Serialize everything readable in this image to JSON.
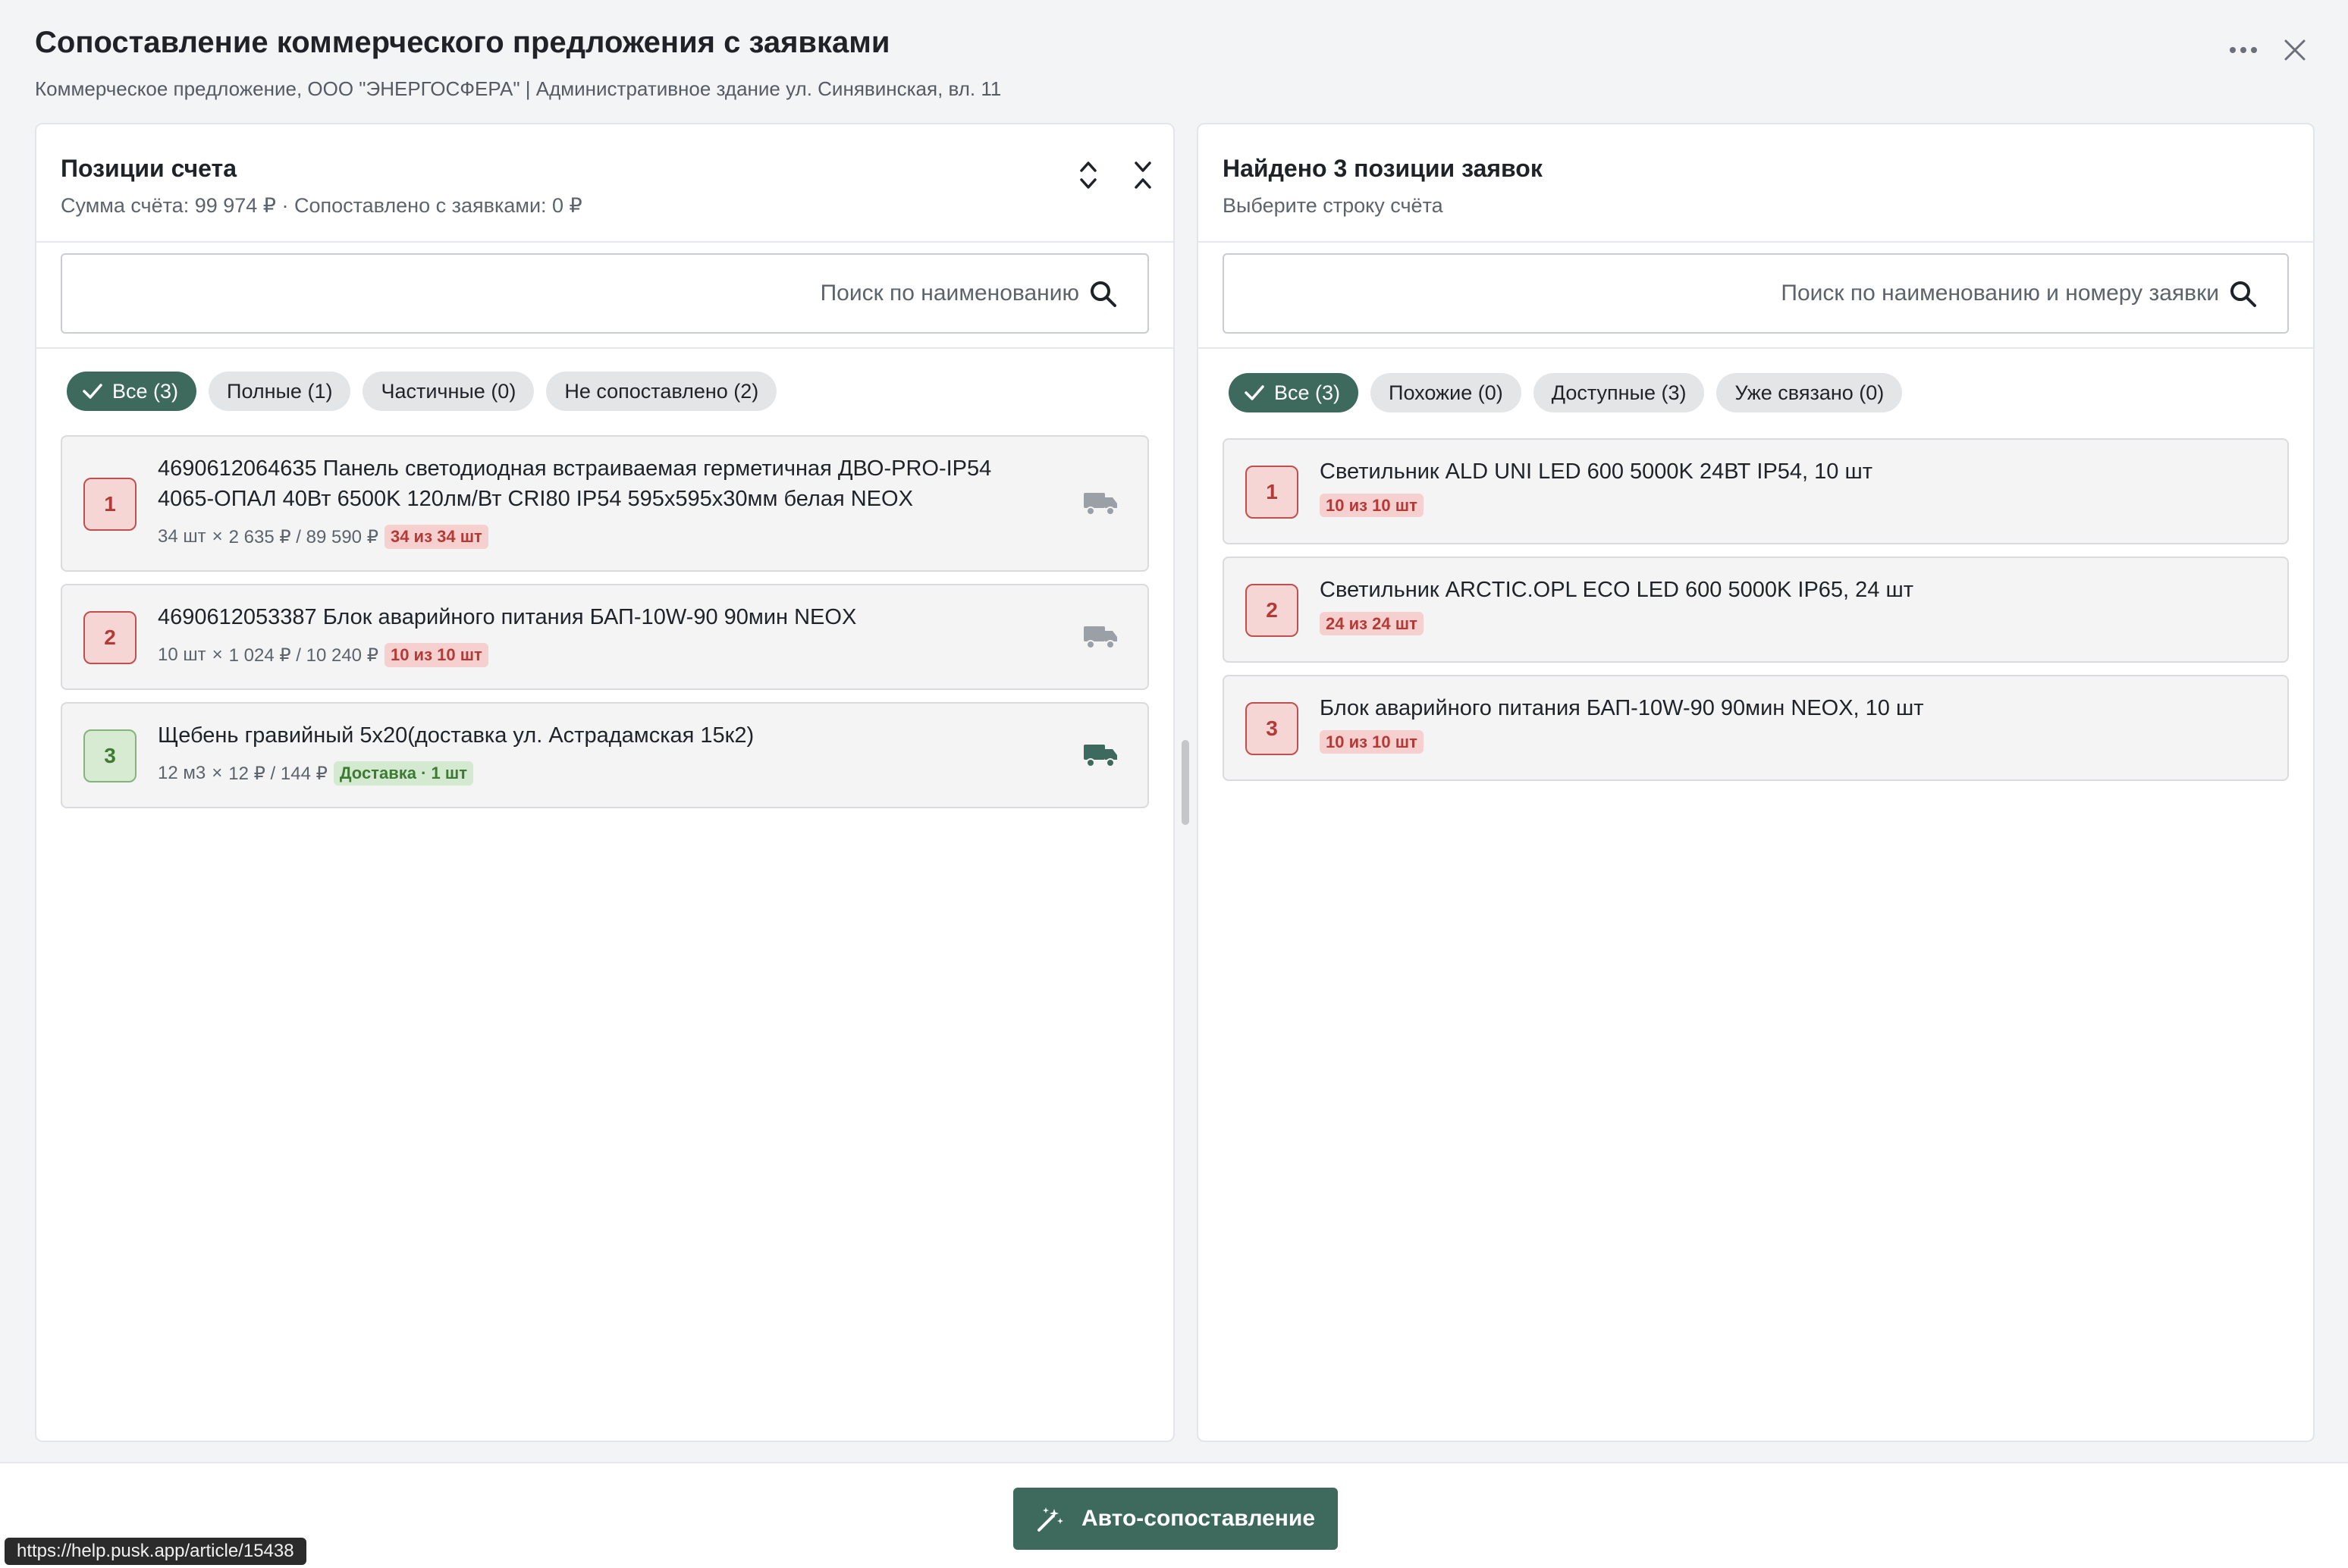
{
  "header": {
    "title": "Сопоставление коммерческого предложения с заявками",
    "subtitle": "Коммерческое предложение, ООО \"ЭНЕРГОСФЕРА\" | Административное здание ул. Синявинская, вл. 11",
    "more_icon": "more-horizontal-icon",
    "close_icon": "close-icon"
  },
  "left_panel": {
    "title": "Позиции счета",
    "summary": "Сумма счёта: 99 974 ₽ · Сопоставлено с заявками: 0 ₽",
    "search_placeholder": "Поиск по наименованию",
    "filters": [
      {
        "label": "Все (3)",
        "active": true
      },
      {
        "label": "Полные (1)",
        "active": false
      },
      {
        "label": "Частичные (0)",
        "active": false
      },
      {
        "label": "Не сопоставлено (2)",
        "active": false
      }
    ],
    "items": [
      {
        "num": "1",
        "title": "4690612064635 Панель светодиодная встраиваемая герметичная ДВО-PRO-IP54 4065-ОПАЛ 40Вт 6500K 120лм/Вт CRI80 IP54 595х595х30мм белая NEOX",
        "qty": "34 шт",
        "times": "×",
        "price_total": "2 635 ₽ / 89 590 ₽",
        "badge": "34 из 34 шт",
        "status": "red"
      },
      {
        "num": "2",
        "title": "4690612053387 Блок аварийного питания БАП-10W-90 90мин NEOX",
        "qty": "10 шт",
        "times": "×",
        "price_total": "1 024 ₽ / 10 240 ₽",
        "badge": "10 из 10 шт",
        "status": "red"
      },
      {
        "num": "3",
        "title": "Щебень гравийный 5х20(доставка ул. Астрадамская 15к2)",
        "qty": "12 м3",
        "times": "×",
        "price_total": "12 ₽ / 144 ₽",
        "badge": "Доставка · 1 шт",
        "status": "green"
      }
    ]
  },
  "right_panel": {
    "title": "Найдено 3 позиции заявок",
    "subtitle": "Выберите строку счёта",
    "search_placeholder": "Поиск по наименованию и номеру заявки",
    "filters": [
      {
        "label": "Все (3)",
        "active": true
      },
      {
        "label": "Похожие (0)",
        "active": false
      },
      {
        "label": "Доступные (3)",
        "active": false
      },
      {
        "label": "Уже связано (0)",
        "active": false
      }
    ],
    "items": [
      {
        "num": "1",
        "title": "Светильник ALD UNI LED 600 5000K 24ВТ IP54, 10 шт",
        "badge": "10 из 10 шт"
      },
      {
        "num": "2",
        "title": "Светильник ARCTIC.OPL ECO LED 600 5000K IP65, 24 шт",
        "badge": "24 из 24 шт"
      },
      {
        "num": "3",
        "title": "Блок аварийного питания БАП-10W-90 90мин NEOX, 10 шт",
        "badge": "10 из 10 шт"
      }
    ]
  },
  "footer": {
    "auto_match_label": "Авто-сопоставление",
    "auto_match_icon": "magic-wand-icon"
  },
  "status_bar": {
    "url": "https://help.pusk.app/article/15438"
  },
  "colors": {
    "accent": "#3d6a5c",
    "badge_red_bg": "#f6cfcf",
    "badge_red_text": "#b23b38",
    "badge_green_bg": "#d4ead0",
    "badge_green_text": "#3f7a35"
  }
}
